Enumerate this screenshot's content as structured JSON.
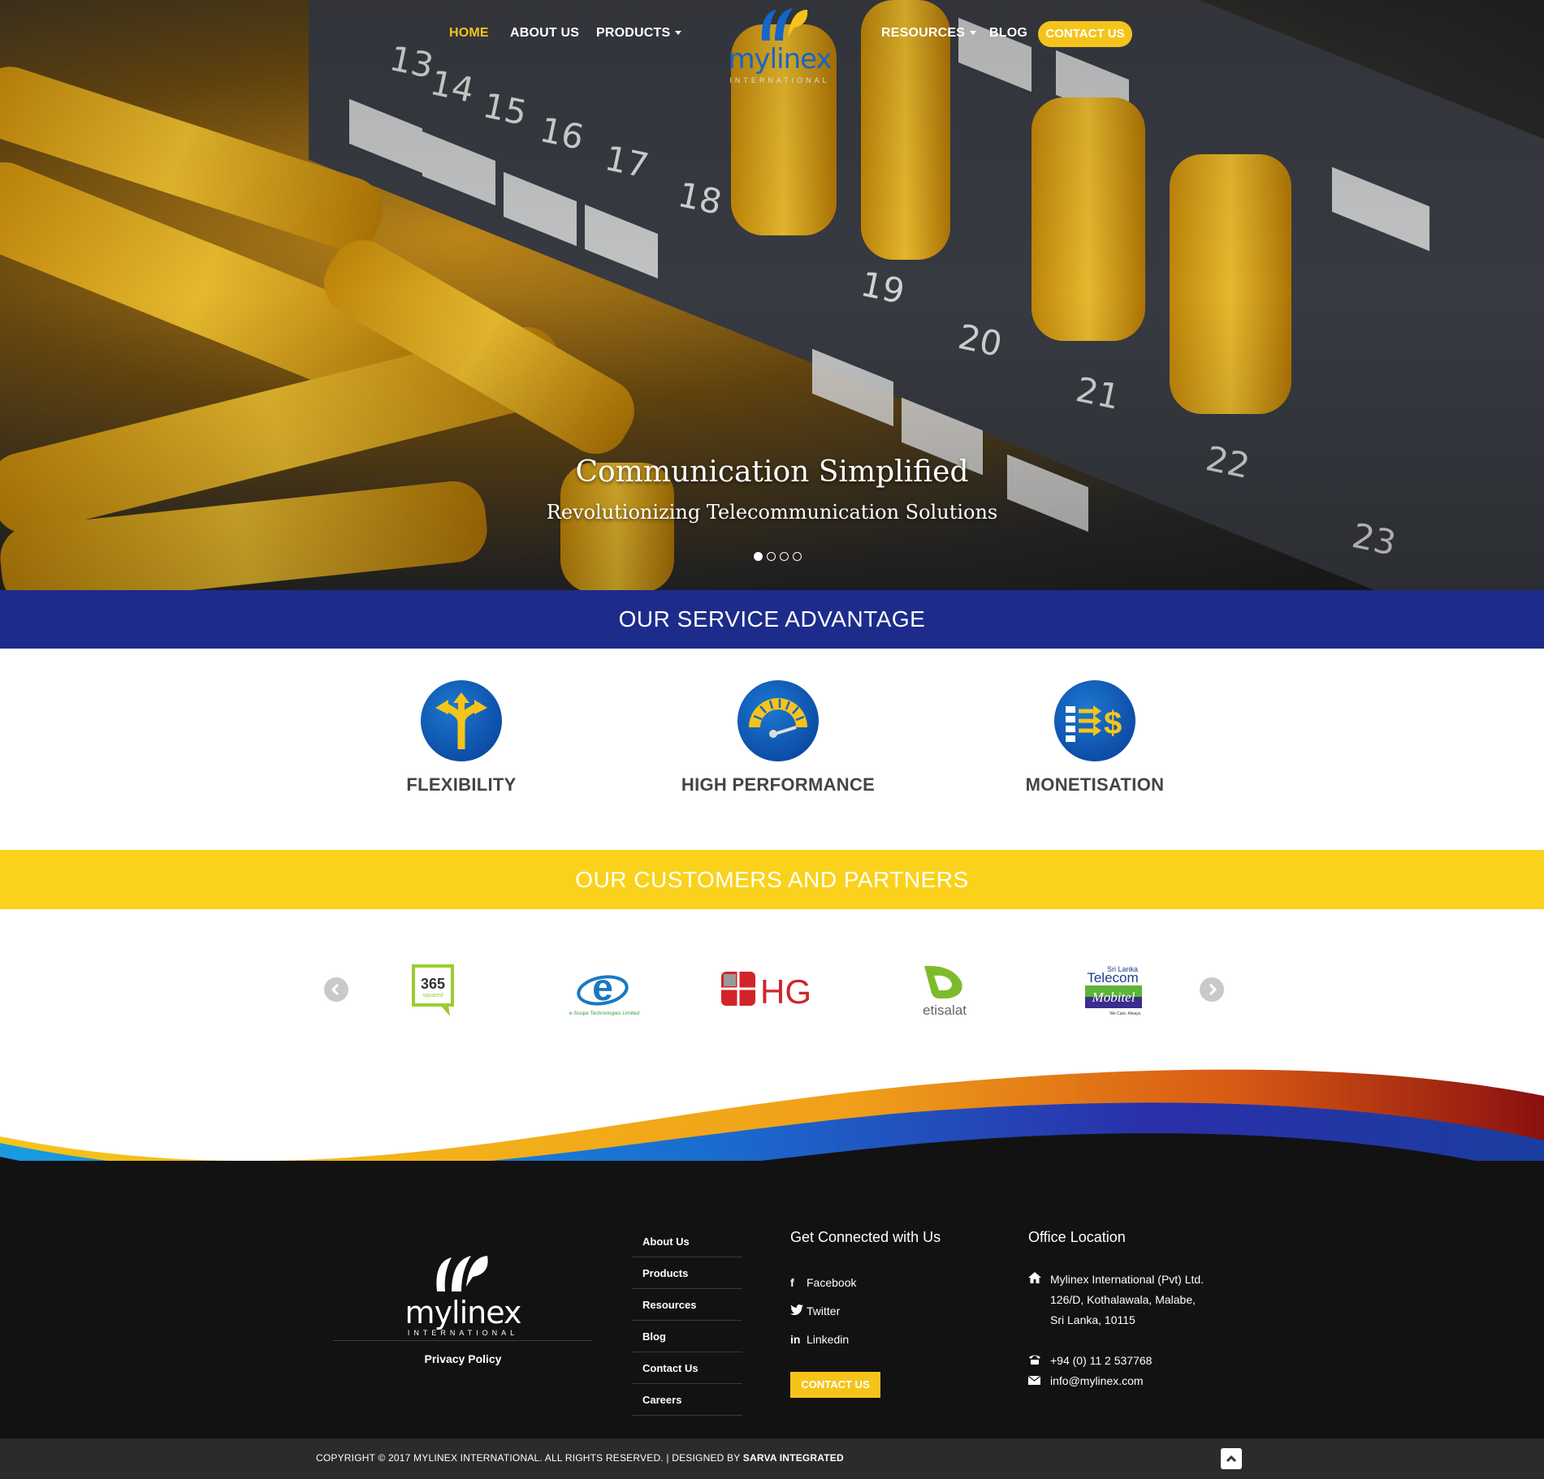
{
  "nav": {
    "home": "HOME",
    "about": "ABOUT US",
    "products": "PRODUCTS",
    "resources": "RESOURCES",
    "blog": "BLOG",
    "contact": "CONTACT US"
  },
  "logo": {
    "word": "mylinex",
    "sub": "INTERNATIONAL"
  },
  "hero": {
    "title": "Communication Simplified",
    "subtitle": "Revolutionizing Telecommunication Solutions",
    "port_numbers": [
      "13",
      "14",
      "15",
      "16",
      "17",
      "18",
      "19",
      "20",
      "21",
      "22",
      "23"
    ],
    "slides": 4,
    "active_slide": 1
  },
  "services": {
    "heading": "OUR SERVICE ADVANTAGE",
    "items": [
      {
        "label": "FLEXIBILITY",
        "icon": "split-arrows-icon"
      },
      {
        "label": "HIGH PERFORMANCE",
        "icon": "speedometer-icon"
      },
      {
        "label": "MONETISATION",
        "icon": "money-flow-icon"
      }
    ]
  },
  "partners": {
    "heading": "OUR CUSTOMERS AND PARTNERS",
    "logos": [
      {
        "name": "365",
        "sub": "squared"
      },
      {
        "name": "e",
        "sub": "e-Scope Technologies Limited"
      },
      {
        "name": "HGC"
      },
      {
        "name": "etisalat"
      },
      {
        "name": "Telecom",
        "top": "Sri Lanka",
        "sub": "Mobitel",
        "tag": "We Care. Always."
      }
    ]
  },
  "footer": {
    "logo_word": "mylinex",
    "logo_sub": "INTERNATIONAL",
    "privacy": "Privacy Policy",
    "links": [
      "About Us",
      "Products",
      "Resources",
      "Blog",
      "Contact Us",
      "Careers"
    ],
    "connect_heading": "Get Connected with Us",
    "social": [
      {
        "icon": "facebook-icon",
        "label": "Facebook"
      },
      {
        "icon": "twitter-icon",
        "label": "Twitter"
      },
      {
        "icon": "linkedin-icon",
        "label": "Linkedin"
      }
    ],
    "contact_button": "CONTACT US",
    "office_heading": "Office Location",
    "address": [
      "Mylinex International (Pvt) Ltd.",
      "126/D, Kothalawala, Malabe,",
      "Sri Lanka, 10115"
    ],
    "phone": "+94 (0) 11 2 537768",
    "email": "info@mylinex.com"
  },
  "copyright": {
    "text": "COPYRIGHT © 2017 MYLINEX INTERNATIONAL. ALL RIGHTS RESERVED. | DESIGNED BY ",
    "designer": "SARVA INTEGRATED"
  },
  "colors": {
    "accent_yellow": "#f5c41b",
    "service_blue": "#1d2c8a",
    "partners_yellow": "#fad21c",
    "footer_bg": "#121212"
  }
}
